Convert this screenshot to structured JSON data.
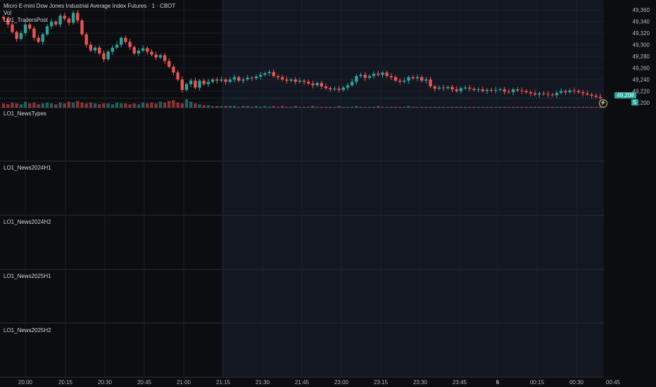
{
  "header": {
    "symbol_title": "Micro E-mini Dow Jones Industrial Average Index Futures · 1 · CBOT",
    "volume_label": "Vol",
    "indicator_label": "LO1_TradersPost"
  },
  "panes": [
    {
      "label": "LO1_NewsTypes"
    },
    {
      "label": "LO1_News2024H1"
    },
    {
      "label": "LO1_News2024H2"
    },
    {
      "label": "LO1_News2025H1"
    },
    {
      "label": "LO1_News2025H2"
    }
  ],
  "price_scale": {
    "ticks": [
      "49,360",
      "49,340",
      "49,320",
      "49,300",
      "49,280",
      "49,260",
      "49,240",
      "49,220",
      "49,200"
    ],
    "last_price_label": "49,208",
    "countdown_label": "5",
    "last_price_color": "#26a69a"
  },
  "time_axis": {
    "ticks": [
      "20:00",
      "20:15",
      "20:30",
      "20:45",
      "21:00",
      "21:15",
      "21:30",
      "21:45",
      "23:00",
      "23:15",
      "23:30",
      "23:45",
      "6",
      "00:15",
      "00:30",
      "00:45"
    ]
  },
  "colors": {
    "up": "#26a69a",
    "down": "#ef5350",
    "session_shade": "#131722",
    "background": "#0c0d10"
  },
  "icons": {
    "replay": "lightning-icon"
  },
  "chart_data": {
    "type": "candlestick",
    "title": "Micro E-mini Dow Jones Industrial Average Index Futures · 1 · CBOT",
    "ylim": [
      49195,
      49370
    ],
    "last_price": 49208,
    "x_ticks": [
      "20:00",
      "20:15",
      "20:30",
      "20:45",
      "21:00",
      "21:15",
      "21:30",
      "21:45",
      "23:00",
      "23:15",
      "23:30",
      "23:45",
      "6",
      "00:15",
      "00:30",
      "00:45"
    ],
    "closes": [
      49345,
      49335,
      49322,
      49310,
      49320,
      49335,
      49328,
      49312,
      49305,
      49318,
      49332,
      49340,
      49335,
      49350,
      49345,
      49338,
      49355,
      49342,
      49318,
      49300,
      49290,
      49295,
      49285,
      49275,
      49288,
      49295,
      49300,
      49312,
      49305,
      49296,
      49285,
      49290,
      49294,
      49288,
      49283,
      49278,
      49282,
      49272,
      49262,
      49252,
      49240,
      49222,
      49232,
      49238,
      49226,
      49238,
      49232,
      49236,
      49240,
      49238,
      49240,
      49236,
      49240,
      49244,
      49238,
      49240,
      49243,
      49242,
      49245,
      49248,
      49251,
      49253,
      49246,
      49244,
      49240,
      49238,
      49240,
      49236,
      49238,
      49236,
      49233,
      49230,
      49234,
      49228,
      49225,
      49223,
      49224,
      49222,
      49226,
      49230,
      49236,
      49246,
      49248,
      49243,
      49246,
      49250,
      49248,
      49252,
      49246,
      49244,
      49238,
      49236,
      49238,
      49244,
      49242,
      49244,
      49238,
      49240,
      49228,
      49224,
      49226,
      49225,
      49227,
      49223,
      49220,
      49225,
      49226,
      49224,
      49222,
      49223,
      49220,
      49222,
      49221,
      49222,
      49223,
      49219,
      49218,
      49223,
      49221,
      49220,
      49218,
      49216,
      49214,
      49216,
      49215,
      49214,
      49213,
      49217,
      49220,
      49218,
      49221,
      49220,
      49218,
      49216,
      49214,
      49212,
      49210,
      49208
    ],
    "volumes": [
      5,
      4,
      6,
      5,
      4,
      7,
      5,
      6,
      4,
      5,
      6,
      5,
      4,
      6,
      5,
      7,
      6,
      8,
      6,
      5,
      6,
      5,
      4,
      5,
      5,
      4,
      6,
      5,
      5,
      4,
      5,
      4,
      6,
      5,
      6,
      5,
      7,
      6,
      8,
      9,
      6,
      5,
      10,
      7,
      5,
      4,
      3,
      3,
      2,
      2,
      2,
      2,
      2,
      2,
      1,
      2,
      2,
      1,
      2,
      1,
      2,
      1,
      2,
      1,
      2,
      1,
      1,
      2,
      1,
      1,
      1,
      2,
      1,
      1,
      1,
      1,
      1,
      2,
      1,
      1,
      1,
      2,
      1,
      1,
      1,
      1,
      2,
      1,
      1,
      1,
      1,
      1,
      1,
      2,
      1,
      1,
      1,
      1,
      1,
      1,
      1,
      1,
      1,
      1,
      1,
      1,
      1,
      1,
      1,
      1,
      1,
      1,
      1,
      1,
      1,
      1,
      1,
      1,
      1,
      1,
      1,
      1,
      1,
      1,
      1,
      1,
      1,
      1,
      1,
      1,
      1,
      1,
      1,
      1,
      1,
      1,
      1,
      1
    ]
  }
}
